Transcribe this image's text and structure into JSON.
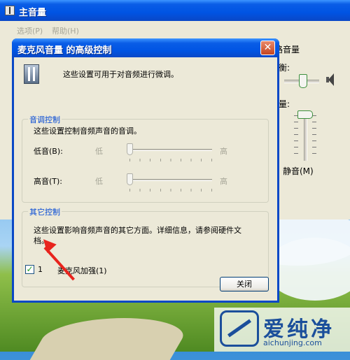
{
  "background_window": {
    "title": "主音量",
    "menu": [
      "选项(P)",
      "帮助(H)"
    ],
    "column_title": "路音量",
    "balance_label": "衡:",
    "volume_label": "量:",
    "mute_label": "静音(M)",
    "balance_level": 0.55,
    "volume_level": 0.0
  },
  "dialog": {
    "title": "麦克风音量 的高级控制",
    "close_glyph": "✕",
    "intro": "这些设置可用于对音频进行微调。",
    "tone_group": {
      "legend": "音调控制",
      "description": "这些设置控制音频声音的音调。",
      "sliders": [
        {
          "label": "低音(B):",
          "min_label": "低",
          "max_label": "高",
          "level": 0.0
        },
        {
          "label": "高音(T):",
          "min_label": "低",
          "max_label": "高",
          "level": 0.0
        }
      ]
    },
    "other_group": {
      "legend": "其它控制",
      "description_line1": "这些设置影响音频声音的其它方面。详细信息，请参阅硬件文",
      "description_line2": "档。",
      "checkbox": {
        "number": "1",
        "label": "麦克风加强(1)",
        "checked": true,
        "check_glyph": "✓"
      }
    },
    "close_button": "关闭"
  },
  "watermark": {
    "brand_cn": "爱纯净",
    "brand_en": "aichunjing.com"
  },
  "colors": {
    "title_bar": "#0054e3",
    "dialog_face": "#ece9d8",
    "group_legend": "#0046d5",
    "arrow": "#e8241d",
    "watermark": "#1b4f9b"
  }
}
